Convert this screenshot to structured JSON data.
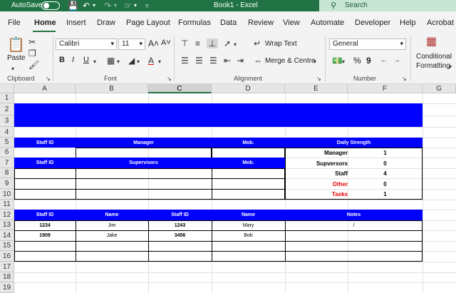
{
  "titlebar": {
    "autosave_label": "AutoSave",
    "autosave_state": "off",
    "document_title": "Book1  -  Excel",
    "search_placeholder": "Search"
  },
  "ribbon_tabs": [
    "File",
    "Home",
    "Insert",
    "Draw",
    "Page Layout",
    "Formulas",
    "Data",
    "Review",
    "View",
    "Automate",
    "Developer",
    "Help",
    "Acrobat"
  ],
  "active_tab": "Home",
  "ribbon": {
    "clipboard": {
      "paste_label": "Paste",
      "group_label": "Clipboard"
    },
    "font": {
      "font_name": "Calibri",
      "font_size": "11",
      "group_label": "Font",
      "bold": "B",
      "italic": "I",
      "underline": "U",
      "grow": "A˄",
      "shrink": "A˅"
    },
    "alignment": {
      "wrap_text": "Wrap Text",
      "merge_centre": "Merge & Centre",
      "group_label": "Alignment"
    },
    "number": {
      "format": "General",
      "group_label": "Number",
      "percent": "%",
      "comma": "9"
    },
    "styles": {
      "conditional_formatting": "Conditional",
      "formatting_line2": "Formatting"
    }
  },
  "sheet": {
    "columns": [
      "A",
      "B",
      "C",
      "D",
      "E",
      "F",
      "G"
    ],
    "selected_column": "C",
    "rows": [
      "1",
      "2",
      "3",
      "4",
      "5",
      "6",
      "7",
      "8",
      "9",
      "10",
      "11",
      "12",
      "13",
      "14",
      "15",
      "16",
      "17",
      "18",
      "19"
    ],
    "header_row5": {
      "staff_id": "Staff ID",
      "manager": "Manager",
      "mob": "Mob.",
      "daily_strength": "Daily Strength"
    },
    "header_row7": {
      "staff_id": "Staff ID",
      "supervisors": "Supervisors",
      "mob": "Mob."
    },
    "daily_strength": [
      {
        "label": "Manager",
        "value": "1",
        "color": "#000000"
      },
      {
        "label": "Supversors",
        "value": "0",
        "color": "#000000"
      },
      {
        "label": "Staff",
        "value": "4",
        "color": "#000000"
      },
      {
        "label": "Other",
        "value": "0",
        "color": "#e00000"
      },
      {
        "label": "Tasks",
        "value": "1",
        "color": "#e00000"
      }
    ],
    "table_header": [
      "Staff ID",
      "Name",
      "Staff ID",
      "Name",
      "Notes"
    ],
    "table_rows": [
      [
        "1234",
        "Jim",
        "1243",
        "Mary",
        "/"
      ],
      [
        "1909",
        "Jake",
        "3456",
        "Bob",
        ""
      ]
    ],
    "fill_color": "#0000ff"
  }
}
